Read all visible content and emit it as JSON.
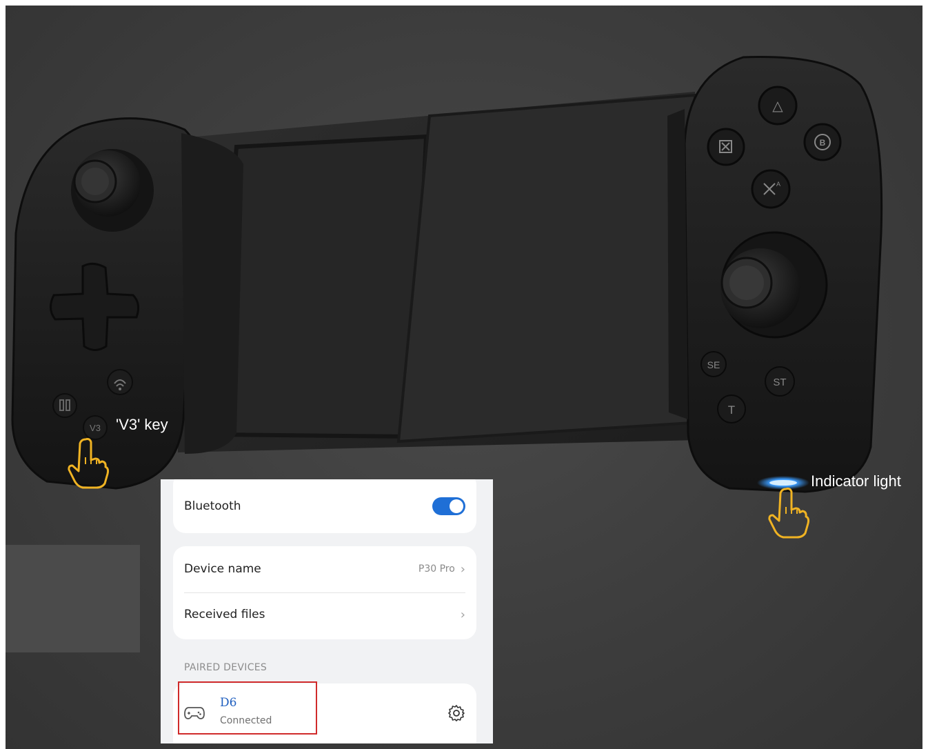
{
  "callouts": {
    "v3_key": "'V3' key",
    "indicator_light": "Indicator light"
  },
  "controller": {
    "left_buttons": {
      "wifi_icon": "wifi-signal",
      "v3": "V3"
    },
    "right_buttons": {
      "triangle": "△",
      "square": "⊠",
      "b": "B",
      "a": "A",
      "se": "SE",
      "st": "ST",
      "t": "T"
    },
    "indicator_color": "#3b9cff"
  },
  "settings": {
    "bluetooth": {
      "label": "Bluetooth",
      "enabled": true,
      "toggle_color": "#1f6fd6"
    },
    "device_name": {
      "label": "Device name",
      "value": "P30 Pro"
    },
    "received_files": {
      "label": "Received files"
    },
    "paired_section": "PAIRED DEVICES",
    "paired_devices": [
      {
        "name": "D6",
        "status": "Connected",
        "icon": "gamepad-icon"
      }
    ],
    "highlight_color": "#d02a2a"
  },
  "accent_colors": {
    "hand_pointer": "#f0b323",
    "label": "#ffffff"
  }
}
